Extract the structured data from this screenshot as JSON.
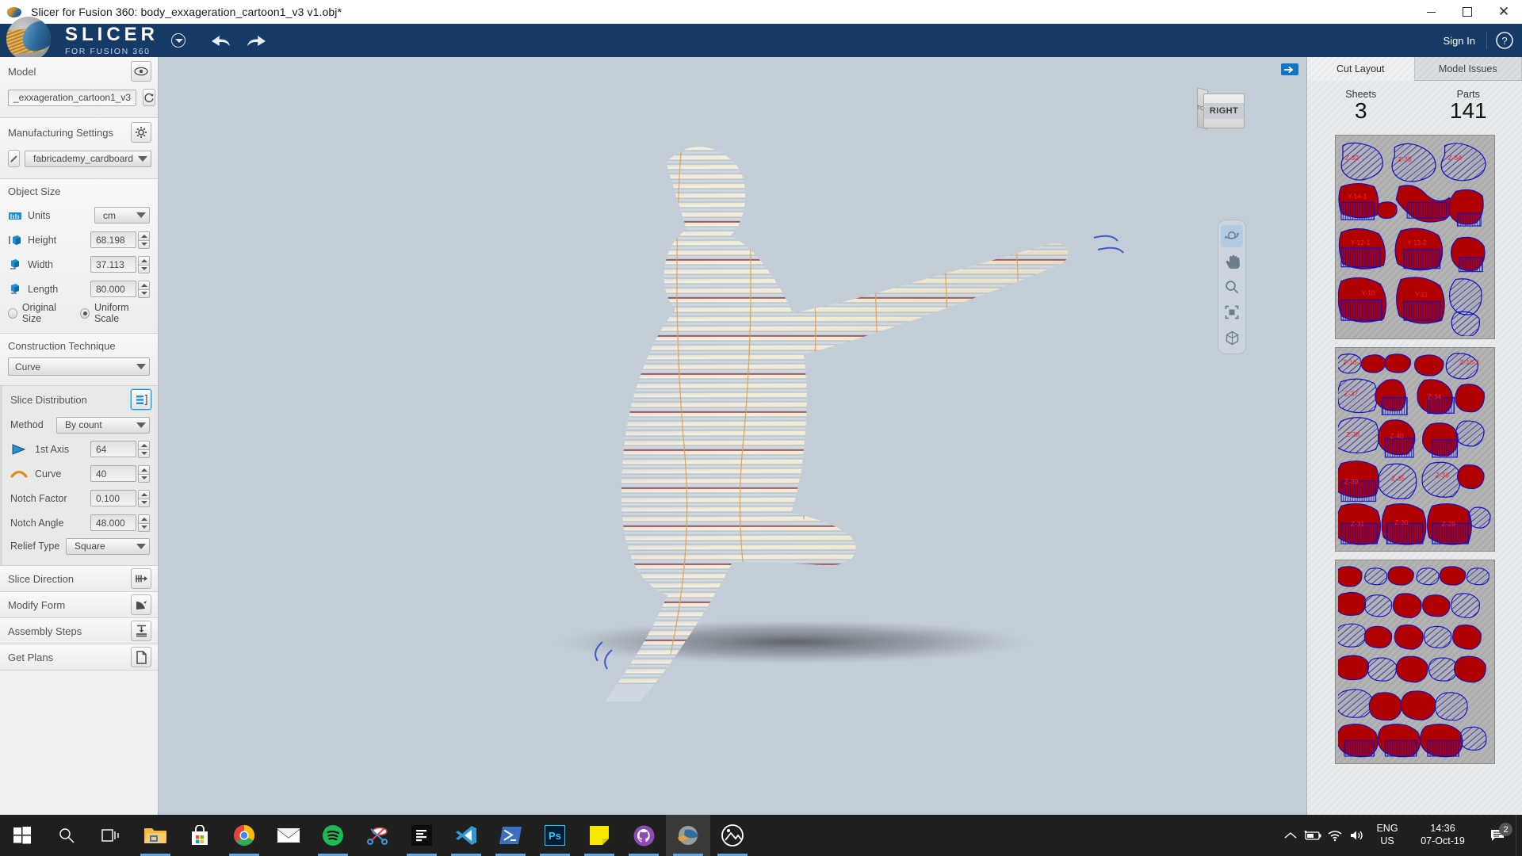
{
  "window": {
    "title": "Slicer for Fusion 360: body_exxageration_cartoon1_v3 v1.obj*",
    "app_icon": "slicer-app-icon",
    "minimize": "minimize-icon",
    "maximize": "maximize-icon",
    "close": "close-icon"
  },
  "header": {
    "brand_main": "SLICER",
    "brand_sub": "FOR FUSION 360",
    "menu_caret": "chevron-down-circle-icon",
    "undo": "undo-icon",
    "redo": "redo-icon",
    "sign_in": "Sign In",
    "help": "help-icon"
  },
  "left_panel": {
    "model": {
      "title": "Model",
      "visibility_icon": "eye-icon",
      "name": "_exxageration_cartoon1_v3",
      "refresh_icon": "refresh-icon"
    },
    "manufacturing": {
      "title": "Manufacturing Settings",
      "gear_icon": "gear-icon",
      "edit_icon": "pencil-icon",
      "material": "fabricademy_cardboard"
    },
    "object_size": {
      "title": "Object Size",
      "units_label": "Units",
      "units_value": "cm",
      "height_label": "Height",
      "height_value": "68.198",
      "width_label": "Width",
      "width_value": "37.113",
      "length_label": "Length",
      "length_value": "80.000",
      "original_size_label": "Original Size",
      "uniform_scale_label": "Uniform Scale",
      "scale_selected": "Uniform Scale"
    },
    "construction": {
      "title": "Construction Technique",
      "value": "Curve"
    },
    "slice_distribution": {
      "title": "Slice Distribution",
      "panel_icon": "slice-distribution-icon",
      "method_label": "Method",
      "method_value": "By count",
      "axis1_label": "1st Axis",
      "axis1_value": "64",
      "curve_label": "Curve",
      "curve_value": "40",
      "notch_factor_label": "Notch Factor",
      "notch_factor_value": "0.100",
      "notch_angle_label": "Notch Angle",
      "notch_angle_value": "48.000",
      "relief_type_label": "Relief Type",
      "relief_type_value": "Square"
    },
    "sections": [
      {
        "title": "Slice Direction",
        "icon": "slice-direction-icon"
      },
      {
        "title": "Modify Form",
        "icon": "modify-form-icon"
      },
      {
        "title": "Assembly Steps",
        "icon": "assembly-steps-icon"
      },
      {
        "title": "Get Plans",
        "icon": "get-plans-icon"
      }
    ]
  },
  "viewport": {
    "expand_icon": "expand-panel-icon",
    "view_cube_face": "RIGHT",
    "view_cube_side": "TOP",
    "nav_tools": [
      {
        "name": "orbit-icon",
        "active": true
      },
      {
        "name": "pan-icon",
        "active": false
      },
      {
        "name": "zoom-icon",
        "active": false
      },
      {
        "name": "fit-icon",
        "active": false
      },
      {
        "name": "view-cube-icon",
        "active": false
      }
    ],
    "bottom_tools": [
      {
        "name": "add-slice-icon"
      },
      {
        "name": "delete-slice-icon"
      },
      {
        "name": "slice-spacing-icon"
      }
    ]
  },
  "right_panel": {
    "tabs": [
      {
        "label": "Cut Layout",
        "active": true
      },
      {
        "label": "Model Issues",
        "active": false
      }
    ],
    "stats": [
      {
        "label": "Sheets",
        "value": "3"
      },
      {
        "label": "Parts",
        "value": "141"
      }
    ],
    "sheets": [
      {
        "name": "sheet-1",
        "part_labels": [
          "Z-32",
          "Z-33",
          "Z-34",
          "Y-14-1",
          "Y-12-1",
          "Y-13-2",
          "Y-10",
          "Y-11"
        ]
      },
      {
        "name": "sheet-2",
        "part_labels": [
          "Z-37",
          "Z-38",
          "Z-35",
          "Z-36",
          "Z-39",
          "Z-31",
          "Z-30",
          "Z-29",
          "Z-16-2"
        ]
      },
      {
        "name": "sheet-3",
        "part_labels": []
      }
    ],
    "colors": {
      "part_outline": "#1010c8",
      "part_fill_red": "#b10000",
      "part_label": "#ff2020",
      "sheet_bg": "#b0b0b0"
    }
  },
  "taskbar": {
    "items": [
      {
        "name": "start-button",
        "icon": "windows-logo-icon",
        "running": false
      },
      {
        "name": "search-button",
        "icon": "search-icon",
        "running": false
      },
      {
        "name": "task-view-button",
        "icon": "task-view-icon",
        "running": false
      },
      {
        "name": "file-explorer",
        "icon": "folder-icon",
        "running": true
      },
      {
        "name": "microsoft-store",
        "icon": "store-icon",
        "running": false
      },
      {
        "name": "google-chrome",
        "icon": "chrome-icon",
        "running": true
      },
      {
        "name": "mail",
        "icon": "mail-icon",
        "running": false
      },
      {
        "name": "spotify",
        "icon": "spotify-icon",
        "running": true
      },
      {
        "name": "snipping-tool",
        "icon": "scissors-icon",
        "running": false
      },
      {
        "name": "sublime-text",
        "icon": "sublime-icon",
        "running": true
      },
      {
        "name": "visual-studio-code",
        "icon": "vscode-icon",
        "running": true
      },
      {
        "name": "powershell",
        "icon": "powershell-icon",
        "running": true
      },
      {
        "name": "photoshop",
        "icon": "photoshop-icon",
        "running": true
      },
      {
        "name": "sticky-notes",
        "icon": "sticky-note-icon",
        "running": true
      },
      {
        "name": "github-desktop",
        "icon": "github-icon",
        "running": true
      },
      {
        "name": "slicer-for-fusion-360",
        "icon": "slicer-app-icon",
        "running": true,
        "active": true
      },
      {
        "name": "photos",
        "icon": "photos-icon",
        "running": true
      }
    ],
    "tray": {
      "show_hidden": "chevron-up-icon",
      "battery": "battery-charging-icon",
      "network": "wifi-icon",
      "volume": "speaker-icon",
      "language_line1": "ENG",
      "language_line2": "US",
      "time": "14:36",
      "date": "07-Oct-19",
      "notifications_icon": "notifications-icon",
      "notifications_count": "2"
    }
  }
}
